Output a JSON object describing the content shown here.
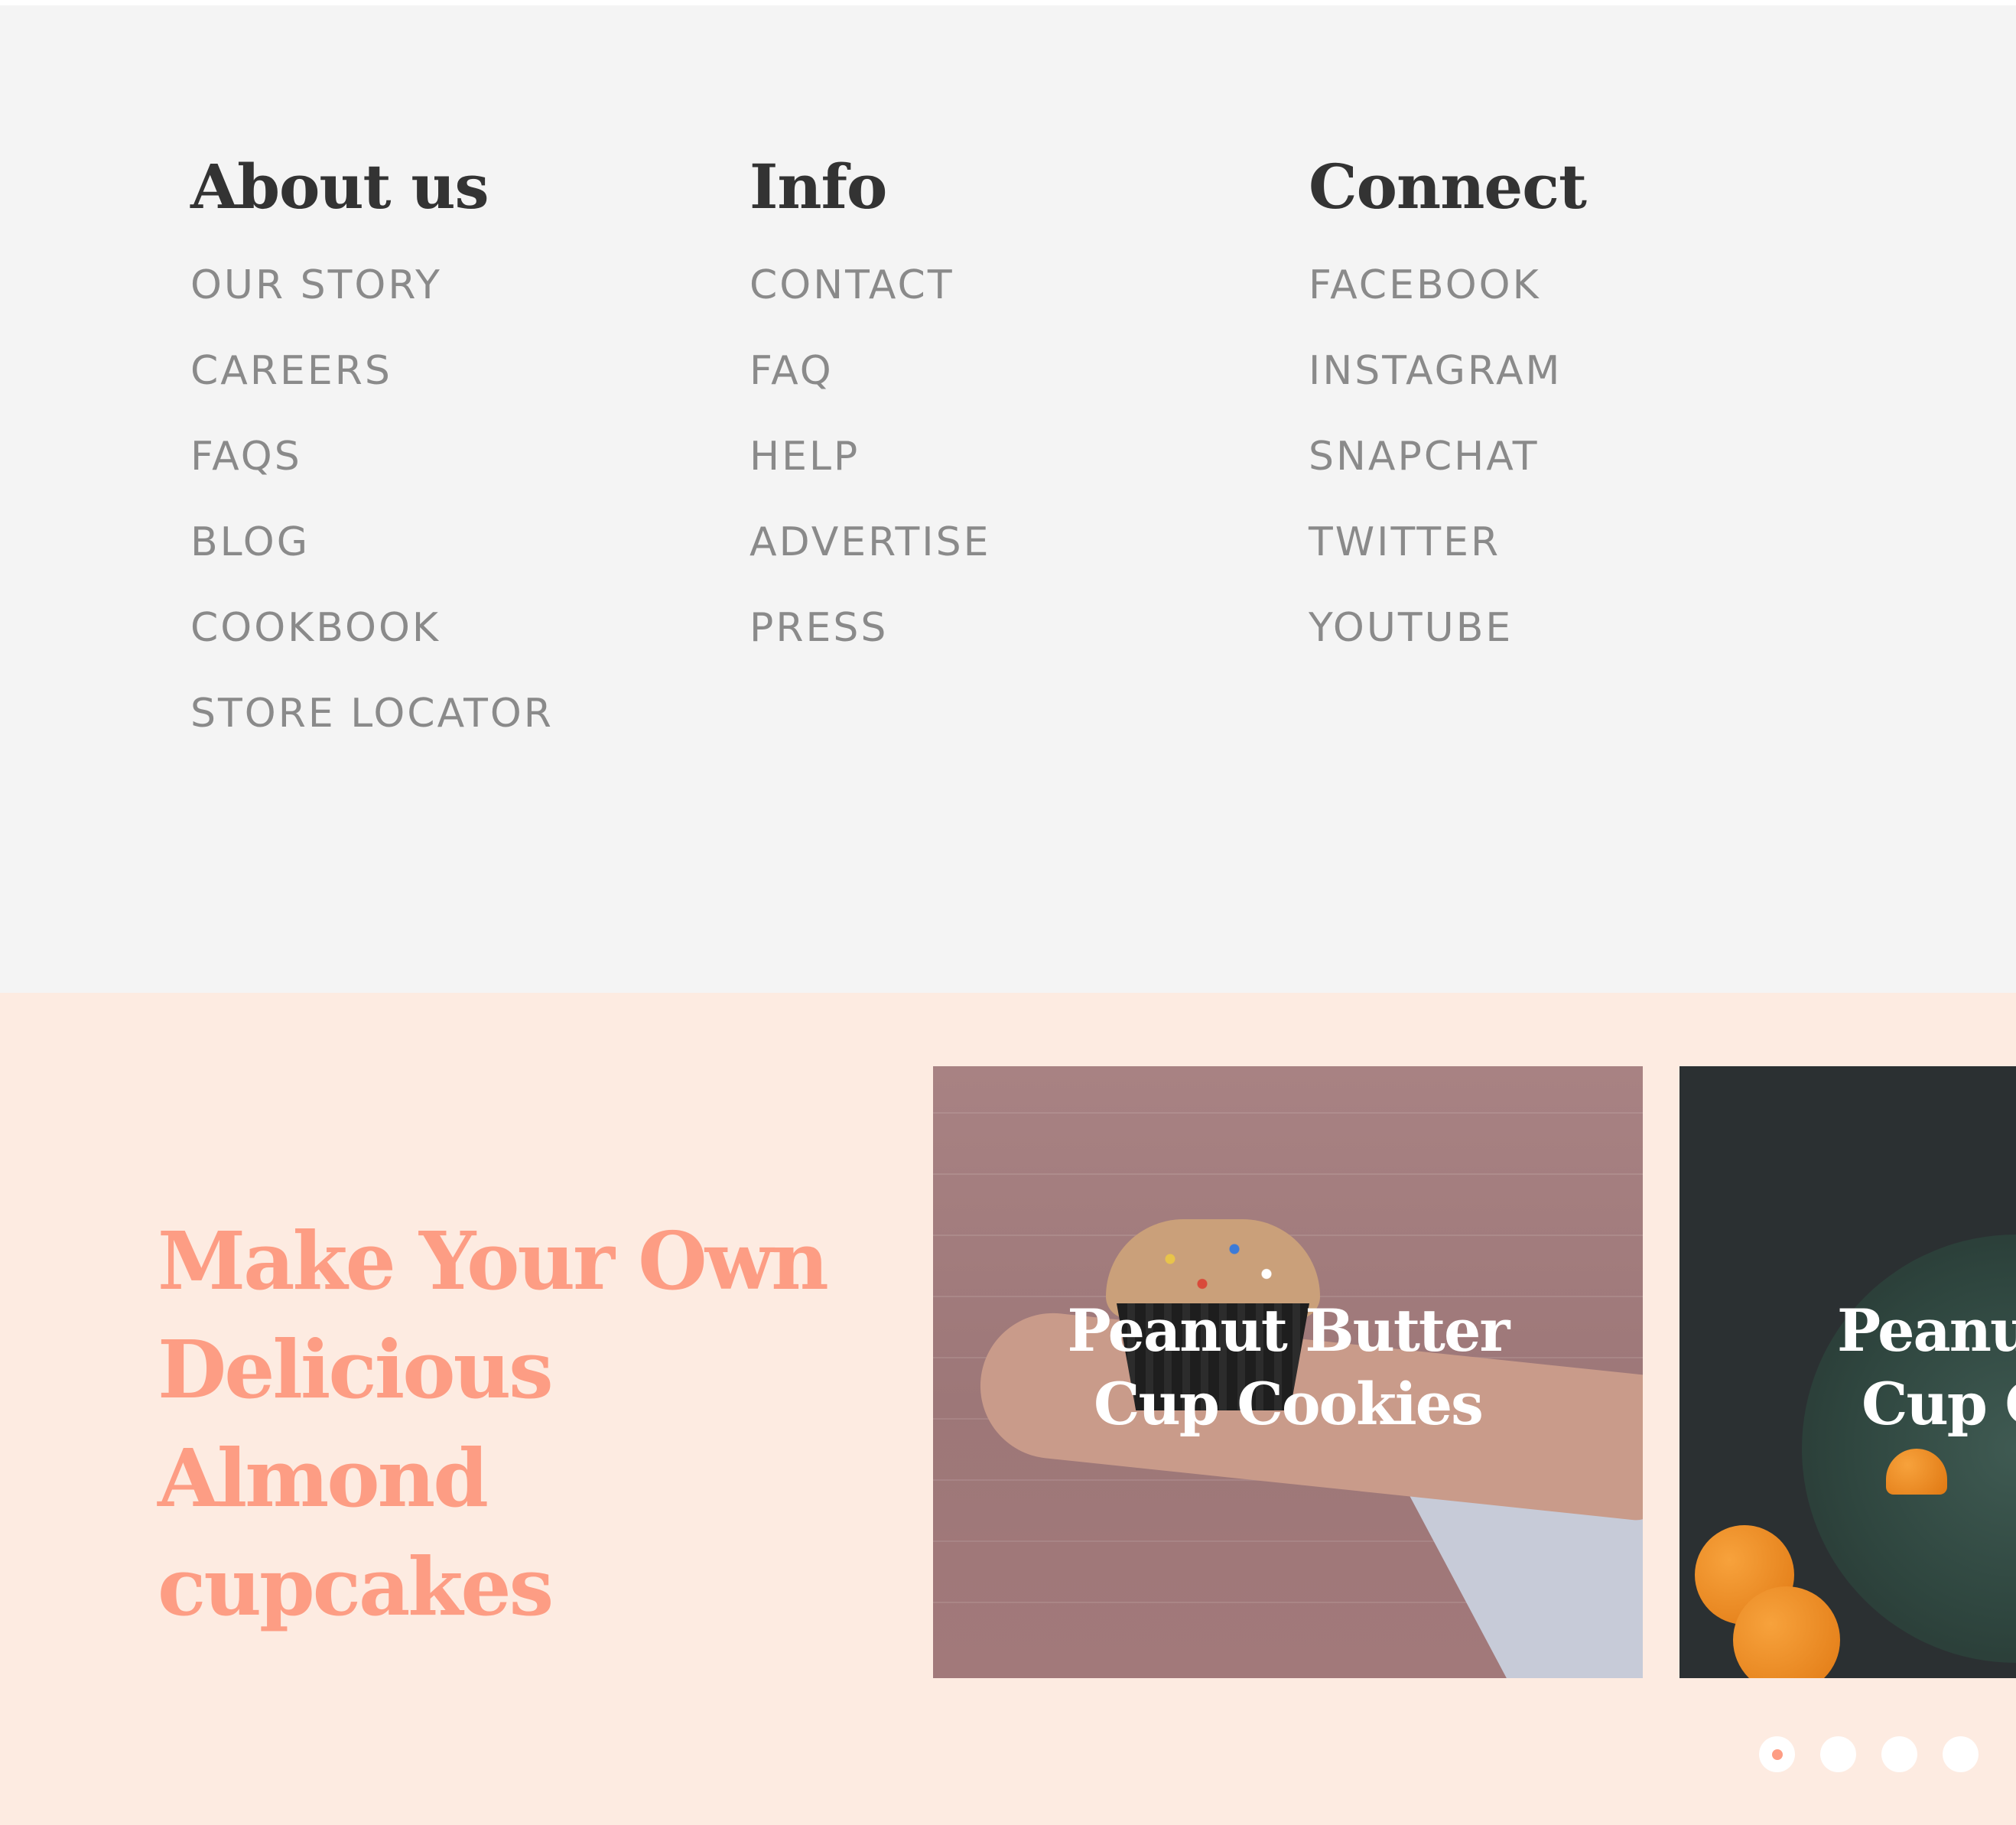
{
  "footer": {
    "columns": [
      {
        "heading": "About us",
        "links": [
          "OUR STORY",
          "CAREERS",
          "FAQS",
          "BLOG",
          "COOKBOOK",
          "STORE LOCATOR"
        ]
      },
      {
        "heading": "Info",
        "links": [
          "CONTACT",
          "FAQ",
          "HELP",
          "ADVERTISE",
          "PRESS"
        ]
      },
      {
        "heading": "Connect",
        "links": [
          "FACEBOOK",
          "INSTAGRAM",
          "SNAPCHAT",
          "TWITTER",
          "YOUTUBE"
        ]
      }
    ]
  },
  "promo": {
    "title": "Make Your Own Delicious Almond cupcakes",
    "cards": [
      {
        "title_line1": "Peanut Butter",
        "title_line2": "Cup Cookies",
        "image_icon": "cupcake-photo"
      },
      {
        "title_line1": "Peanut Butter",
        "title_line2": "Cup Cookies",
        "image_icon": "pancake-plate-photo"
      }
    ],
    "carousel": {
      "dot_count": 4,
      "active_index": 0
    }
  },
  "colors": {
    "footer_bg": "#f4f4f4",
    "heading": "#333333",
    "link": "#8a8a8a",
    "promo_bg": "#fdebe1",
    "accent": "#fd9d84"
  }
}
